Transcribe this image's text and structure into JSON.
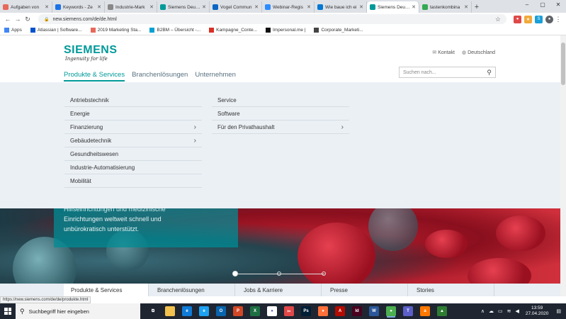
{
  "browser": {
    "tabs": [
      {
        "title": "Aufgaben von",
        "icon": "asana-icon",
        "color": "#e8685a"
      },
      {
        "title": "Keywords - Ze",
        "icon": "search-icon",
        "color": "#1a73e8"
      },
      {
        "title": "Industrie-Mark",
        "icon": "link-icon",
        "color": "#888888"
      },
      {
        "title": "Siemens Deutsc",
        "icon": "siemens-icon",
        "color": "#009999"
      },
      {
        "title": "Vogel Commun",
        "icon": "linkedin-icon",
        "color": "#0a66c2"
      },
      {
        "title": "Webinar-Regis",
        "icon": "zoom-icon",
        "color": "#2d8cff"
      },
      {
        "title": "Wie baue ich ei",
        "icon": "infinity-icon",
        "color": "#0078d4"
      },
      {
        "title": "Siemens Deutsc",
        "icon": "siemens-icon",
        "color": "#009999",
        "active": true
      },
      {
        "title": "tastenkombina",
        "icon": "google-icon",
        "color": "#34a853"
      }
    ],
    "url": "new.siemens.com/de/de.html",
    "bookmarks": [
      {
        "label": "Apps",
        "color": "#4285f4"
      },
      {
        "label": "Atlassian | Software...",
        "color": "#0052cc"
      },
      {
        "label": "2019 Marketing Sta...",
        "color": "#e8685a"
      },
      {
        "label": "B2BM – Übersicht -...",
        "color": "#00a0d0"
      },
      {
        "label": "Kampagne_Conte...",
        "color": "#d93025"
      },
      {
        "label": "Impersonal.me |",
        "color": "#111111"
      },
      {
        "label": "Corporate_Marketi...",
        "color": "#444444"
      }
    ],
    "status_url": "https://new.siemens.com/de/de/produkte.html"
  },
  "site": {
    "brand": "SIEMENS",
    "tagline": "Ingenuity for life",
    "toplinks": {
      "contact": "Kontakt",
      "country": "Deutschland"
    },
    "nav": [
      {
        "label": "Produkte & Services",
        "active": true
      },
      {
        "label": "Branchenlösungen"
      },
      {
        "label": "Unternehmen"
      }
    ],
    "search_placeholder": "Suchen nach...",
    "menu_left": [
      {
        "label": "Antriebstechnik"
      },
      {
        "label": "Energie"
      },
      {
        "label": "Finanzierung",
        "chevron": true
      },
      {
        "label": "Gebäudetechnik",
        "chevron": true
      },
      {
        "label": "Gesundheitswesen"
      },
      {
        "label": "Industrie-Automatisierung"
      },
      {
        "label": "Mobilität"
      }
    ],
    "menu_right": [
      {
        "label": "Service"
      },
      {
        "label": "Software"
      },
      {
        "label": "Für den Privathaushalt",
        "chevron": true
      }
    ],
    "hero_lines": [
      "Hilfseinrichtungen und medizinische",
      "Einrichtungen weltweit schnell und",
      "unbürokratisch unterstützt."
    ],
    "bottom_tabs": [
      {
        "label": "Produkte & Services",
        "active": true
      },
      {
        "label": "Branchenlösungen"
      },
      {
        "label": "Jobs & Karriere"
      },
      {
        "label": "Presse"
      },
      {
        "label": "Stories"
      }
    ]
  },
  "taskbar": {
    "search_placeholder": "Suchbegriff hier eingeben",
    "apps": [
      {
        "icon": "task-view-icon",
        "color": "#1f2632",
        "glyph": "⧉"
      },
      {
        "icon": "file-explorer-icon",
        "color": "#f2c14e",
        "glyph": ""
      },
      {
        "icon": "edge-icon",
        "color": "#0f7bd8",
        "glyph": "e"
      },
      {
        "icon": "ie-icon",
        "color": "#1ea1f1",
        "glyph": "e"
      },
      {
        "icon": "outlook-icon",
        "color": "#0a64ad",
        "glyph": "O"
      },
      {
        "icon": "powerpoint-icon",
        "color": "#d24726",
        "glyph": "P"
      },
      {
        "icon": "excel-icon",
        "color": "#1d6f42",
        "glyph": "X"
      },
      {
        "icon": "teams-icon",
        "color": "#ffffff",
        "glyph": "●"
      },
      {
        "icon": "snip-icon",
        "color": "#e04848",
        "glyph": "✂"
      },
      {
        "icon": "photoshop-icon",
        "color": "#001e36",
        "glyph": "Ps"
      },
      {
        "icon": "firefox-icon",
        "color": "#ff7139",
        "glyph": "●"
      },
      {
        "icon": "acrobat-icon",
        "color": "#b30b00",
        "glyph": "A"
      },
      {
        "icon": "indesign-icon",
        "color": "#49021f",
        "glyph": "Id"
      },
      {
        "icon": "word-icon",
        "color": "#2b579a",
        "glyph": "W"
      },
      {
        "icon": "chrome-icon",
        "color": "#4caf50",
        "glyph": "●",
        "active": true
      },
      {
        "icon": "teams-purple-icon",
        "color": "#5b5fc7",
        "glyph": "T"
      },
      {
        "icon": "avast-icon",
        "color": "#ff7800",
        "glyph": "a"
      },
      {
        "icon": "app-icon",
        "color": "#2e7d32",
        "glyph": "▲"
      }
    ],
    "time": "13:59",
    "date": "27.04.2020"
  }
}
